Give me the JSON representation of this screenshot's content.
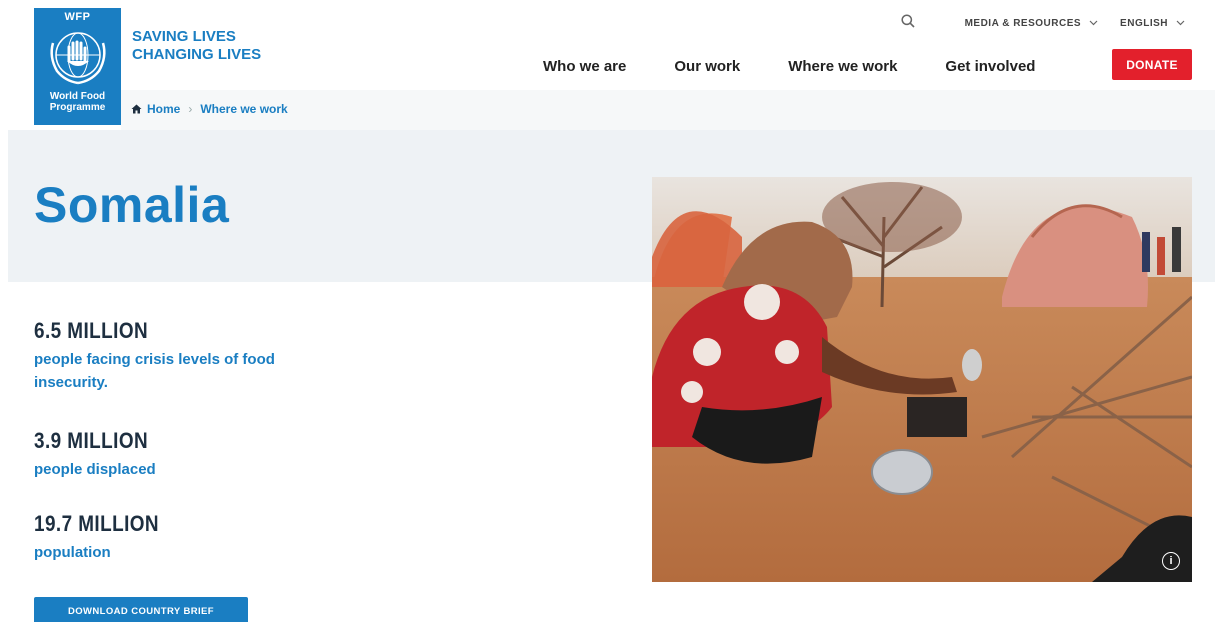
{
  "logo": {
    "abbr": "WFP",
    "name_line1": "World Food",
    "name_line2": "Programme"
  },
  "tagline": {
    "line1": "SAVING LIVES",
    "line2": "CHANGING LIVES"
  },
  "utility_nav": {
    "media": "MEDIA & RESOURCES",
    "language": "ENGLISH"
  },
  "main_nav": {
    "items": [
      "Who we are",
      "Our work",
      "Where we work",
      "Get involved"
    ],
    "donate": "DONATE"
  },
  "breadcrumb": {
    "home": "Home",
    "current": "Where we work"
  },
  "page": {
    "title": "Somalia"
  },
  "stats": [
    {
      "value": "6.5 MILLION",
      "label": "people facing crisis levels of food insecurity."
    },
    {
      "value": "3.9 MILLION",
      "label": "people displaced"
    },
    {
      "value": "19.7 MILLION",
      "label": "population"
    }
  ],
  "cta": {
    "brief": "DOWNLOAD COUNTRY BRIEF"
  },
  "photo": {
    "info_icon": "i"
  },
  "colors": {
    "brand_blue": "#1a7ec2",
    "donate_red": "#e3202c",
    "hero_bg": "#eef2f5"
  }
}
